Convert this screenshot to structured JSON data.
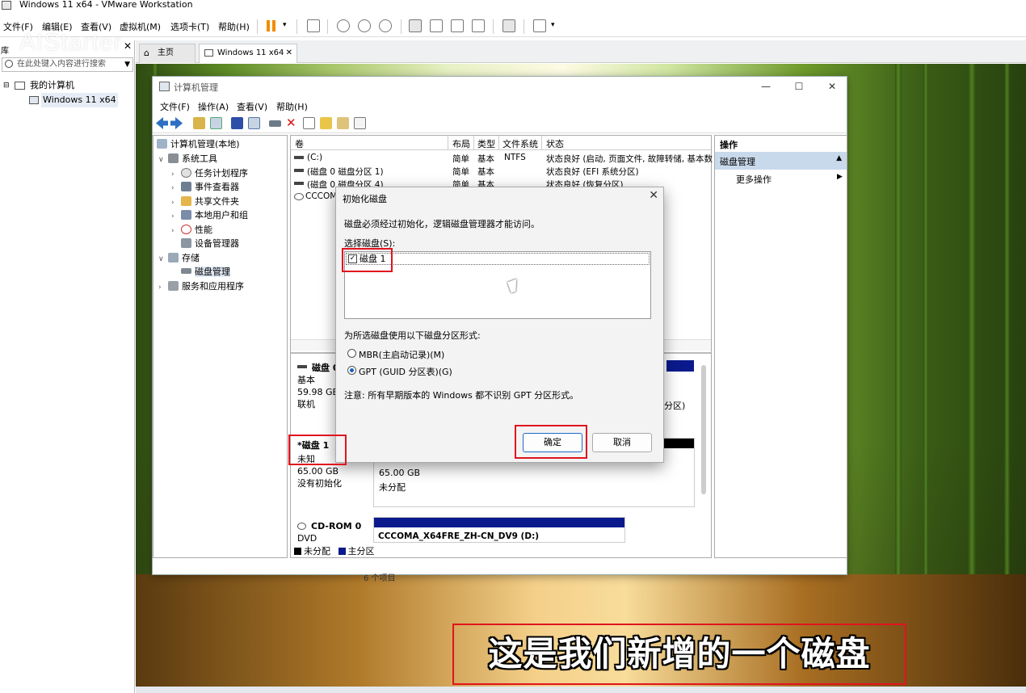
{
  "vmware": {
    "title": "Windows 11 x64 - VMware Workstation",
    "menu": [
      "文件(F)",
      "编辑(E)",
      "查看(V)",
      "虚拟机(M)",
      "选项卡(T)",
      "帮助(H)"
    ],
    "watermark": "AIStarter",
    "library": {
      "header": "库",
      "search_placeholder": "在此处键入内容进行搜索",
      "root": "我的计算机",
      "vm": "Windows 11 x64"
    },
    "tabs": [
      {
        "label": "主页"
      },
      {
        "label": "Windows 11 x64"
      }
    ]
  },
  "cm": {
    "title": "计算机管理",
    "menu": [
      "文件(F)",
      "操作(A)",
      "查看(V)",
      "帮助(H)"
    ],
    "tree": {
      "root": "计算机管理(本地)",
      "system_tools": "系统工具",
      "task_scheduler": "任务计划程序",
      "event_viewer": "事件查看器",
      "shared_folders": "共享文件夹",
      "local_users": "本地用户和组",
      "performance": "性能",
      "device_manager": "设备管理器",
      "storage": "存储",
      "disk_management": "磁盘管理",
      "services": "服务和应用程序"
    },
    "volumes": {
      "headers": [
        "卷",
        "布局",
        "类型",
        "文件系统",
        "状态"
      ],
      "rows": [
        {
          "name": "(C:)",
          "layout": "简单",
          "type": "基本",
          "fs": "NTFS",
          "status": "状态良好 (启动, 页面文件, 故障转储, 基本数"
        },
        {
          "name": "(磁盘 0 磁盘分区 1)",
          "layout": "简单",
          "type": "基本",
          "fs": "",
          "status": "状态良好 (EFI 系统分区)"
        },
        {
          "name": "(磁盘 0 磁盘分区 4)",
          "layout": "简单",
          "type": "基本",
          "fs": "",
          "status": "状态良好 (恢复分区)"
        },
        {
          "name": "CCCOM",
          "layout": "",
          "type": "",
          "fs": "",
          "status": ""
        }
      ]
    },
    "disks": {
      "disk0": {
        "name": "磁盘 0",
        "type": "基本",
        "size": "59.98 GB",
        "status": "联机",
        "partition_tail": "分区)"
      },
      "disk1": {
        "name": "*磁盘 1",
        "type": "未知",
        "size": "65.00 GB",
        "status": "没有初始化",
        "area_size": "65.00 GB",
        "area_status": "未分配"
      },
      "cdrom": {
        "name": "CD-ROM 0",
        "type": "DVD",
        "volume": "CCCOMA_X64FRE_ZH-CN_DV9  (D:)"
      }
    },
    "legend": {
      "unallocated": "未分配",
      "primary": "主分区"
    },
    "actions": {
      "header": "操作",
      "selected": "磁盘管理",
      "more": "更多操作"
    },
    "status_bar": "6 个项目"
  },
  "dialog": {
    "title": "初始化磁盘",
    "message": "磁盘必须经过初始化，逻辑磁盘管理器才能访问。",
    "select_label": "选择磁盘(S):",
    "disk_item": "磁盘 1",
    "disk_checked": true,
    "partition_label": "为所选磁盘使用以下磁盘分区形式:",
    "mbr": "MBR(主启动记录)(M)",
    "gpt": "GPT (GUID 分区表)(G)",
    "selected_style": "GPT",
    "note": "注意: 所有早期版本的 Windows 都不识别 GPT 分区形式。",
    "ok": "确定",
    "cancel": "取消"
  },
  "caption": "这是我们新增的一个磁盘",
  "colors": {
    "highlight_red": "#e0141e",
    "primary_partition": "#0a1a8c",
    "unallocated": "#000000"
  }
}
